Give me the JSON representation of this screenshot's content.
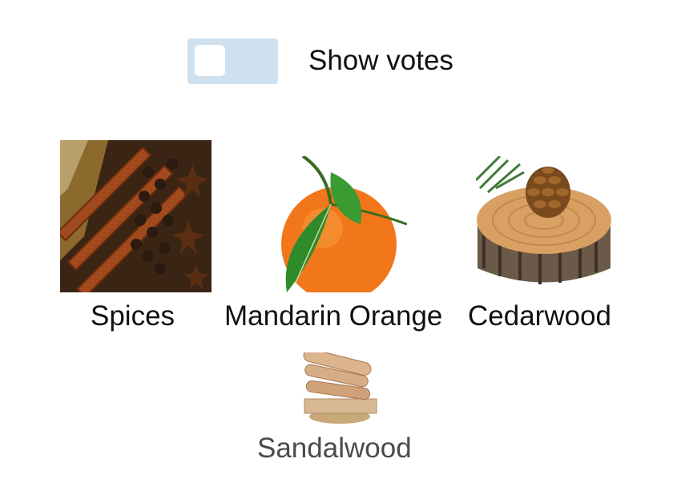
{
  "toggle": {
    "label": "Show votes",
    "checked": false,
    "track_color": "#cfe0ee"
  },
  "scents": [
    {
      "name": "Spices",
      "image": "spices-image"
    },
    {
      "name": "Mandarin Orange",
      "image": "mandarin-orange-image"
    },
    {
      "name": "Cedarwood",
      "image": "cedarwood-image"
    },
    {
      "name": "Sandalwood",
      "image": "sandalwood-image"
    }
  ]
}
